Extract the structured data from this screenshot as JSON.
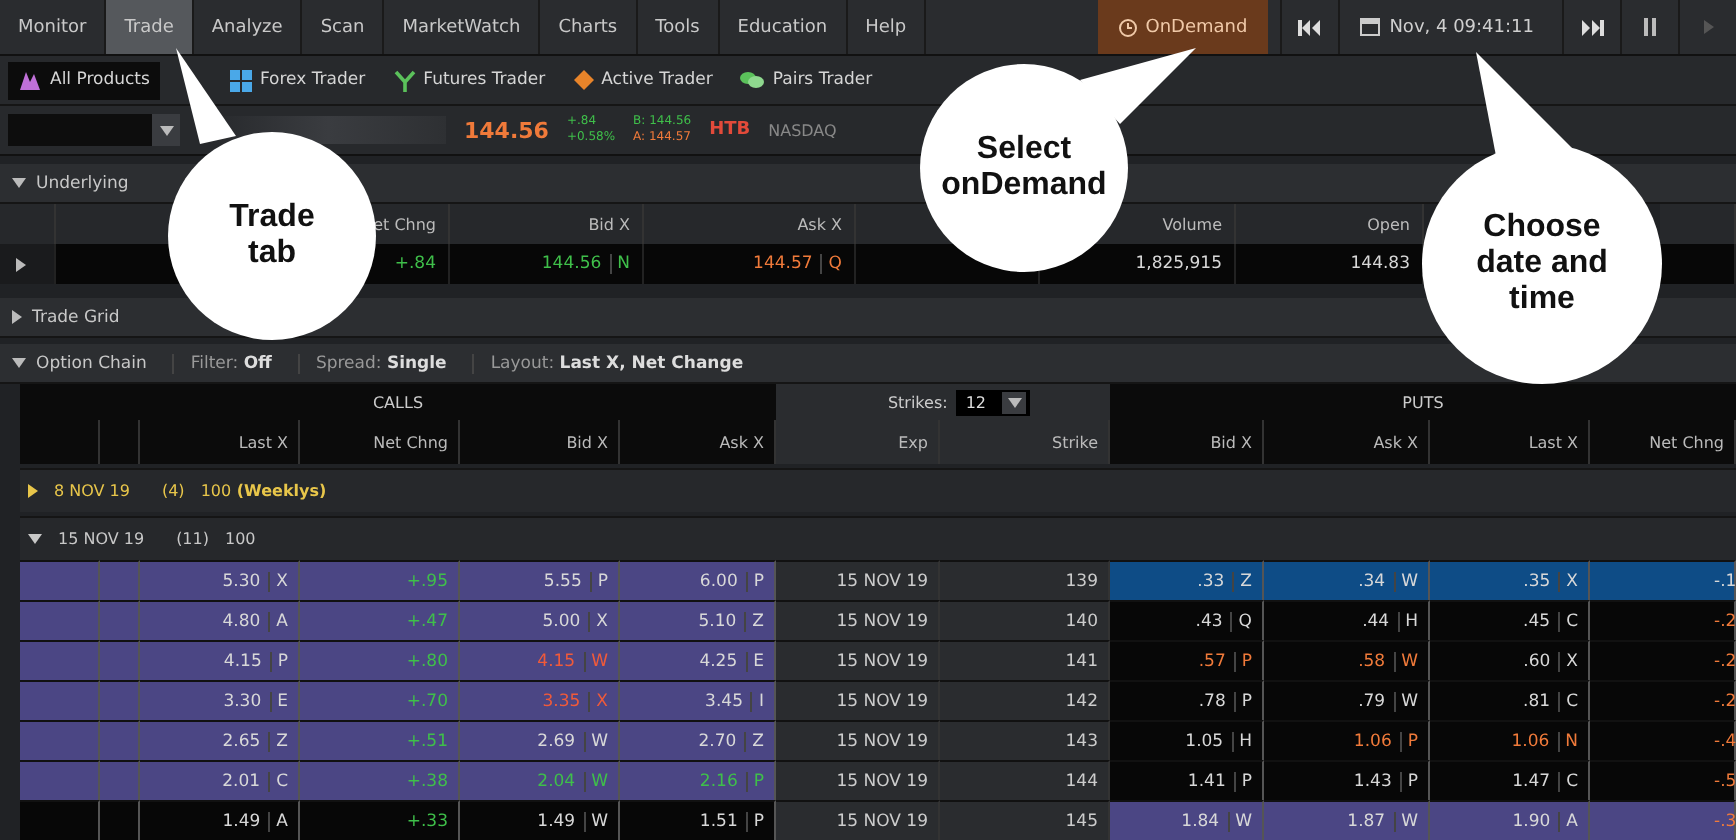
{
  "menu": {
    "tabs": [
      {
        "label": "Monitor",
        "selected": false
      },
      {
        "label": "Trade",
        "selected": true
      },
      {
        "label": "Analyze",
        "selected": false
      },
      {
        "label": "Scan",
        "selected": false
      },
      {
        "label": "MarketWatch",
        "selected": false
      },
      {
        "label": "Charts",
        "selected": false
      },
      {
        "label": "Tools",
        "selected": false
      },
      {
        "label": "Education",
        "selected": false
      },
      {
        "label": "Help",
        "selected": false
      }
    ],
    "ondemand": "OnDemand",
    "datetime": "Nov, 4 09:41:11"
  },
  "products": [
    {
      "label": "All Products",
      "selected": true
    },
    {
      "label": "Forex Trader",
      "selected": false
    },
    {
      "label": "Futures Trader",
      "selected": false
    },
    {
      "label": "Active Trader",
      "selected": false
    },
    {
      "label": "Pairs Trader",
      "selected": false
    }
  ],
  "quote": {
    "last": "144.56",
    "change": "+.84",
    "change_pct": "+0.58%",
    "bid": "B: 144.56",
    "ask": "A: 144.57",
    "flag": "HTB",
    "exchange": "NASDAQ"
  },
  "underlying": {
    "title": "Underlying",
    "expanded": true,
    "columns": [
      "et Chng",
      "Bid X",
      "Ask X",
      "Volume",
      "Open"
    ],
    "cells": [
      {
        "value": "+.84",
        "color": "#3fbf4a"
      },
      {
        "value": "144.56",
        "exch": "N",
        "color": "#3fbf4a"
      },
      {
        "value": "144.57",
        "exch": "Q",
        "color": "#f07a3a"
      },
      {
        "value": "1,825,915",
        "color": "#d8d8d8"
      },
      {
        "value": "144.83",
        "color": "#d8d8d8"
      }
    ]
  },
  "trade_grid": {
    "title": "Trade Grid",
    "expanded": false
  },
  "option_chain": {
    "title": "Option Chain",
    "expanded": true,
    "settings": [
      {
        "label": "Filter:",
        "value": "Off"
      },
      {
        "label": "Spread:",
        "value": "Single"
      },
      {
        "label": "Layout:",
        "value": "Last X, Net Change"
      }
    ],
    "calls_title": "CALLS",
    "puts_title": "PUTS",
    "strikes_label": "Strikes:",
    "strikes_value": "12",
    "call_columns": [
      "Last X",
      "Net Chng",
      "Bid X",
      "Ask X"
    ],
    "mid_columns": [
      "Exp",
      "Strike"
    ],
    "put_columns": [
      "Bid X",
      "Ask X",
      "Last X",
      "Net Chng"
    ],
    "series": [
      {
        "date": "8 NOV 19",
        "count": "(4)",
        "multiplier": "100",
        "note": "(Weeklys)",
        "kind": "weekly",
        "expanded": false
      },
      {
        "date": "15 NOV 19",
        "count": "(11)",
        "multiplier": "100",
        "kind": "standard",
        "expanded": true
      }
    ],
    "rows": [
      {
        "calls_itm": true,
        "puts_itm": false,
        "selected": true,
        "exp": "15 NOV 19",
        "strike": "139",
        "calls": [
          {
            "value": "5.30",
            "exch": "X",
            "color": "#d8d8d8"
          },
          {
            "value": "+.95",
            "color": "#3fbf4a"
          },
          {
            "value": "5.55",
            "exch": "P",
            "color": "#d8d8d8"
          },
          {
            "value": "6.00",
            "exch": "P",
            "color": "#d8d8d8"
          }
        ],
        "puts": [
          {
            "value": ".33",
            "exch": "Z",
            "color": "#d8d8d8"
          },
          {
            "value": ".34",
            "exch": "W",
            "color": "#d8d8d8"
          },
          {
            "value": ".35",
            "exch": "X",
            "color": "#d8d8d8"
          },
          {
            "value": "-.1",
            "color": "#d8d8d8"
          }
        ]
      },
      {
        "calls_itm": true,
        "puts_itm": false,
        "selected": false,
        "exp": "15 NOV 19",
        "strike": "140",
        "calls": [
          {
            "value": "4.80",
            "exch": "A",
            "color": "#d8d8d8"
          },
          {
            "value": "+.47",
            "color": "#3fbf4a"
          },
          {
            "value": "5.00",
            "exch": "X",
            "color": "#d8d8d8"
          },
          {
            "value": "5.10",
            "exch": "Z",
            "color": "#d8d8d8"
          }
        ],
        "puts": [
          {
            "value": ".43",
            "exch": "Q",
            "color": "#d8d8d8"
          },
          {
            "value": ".44",
            "exch": "H",
            "color": "#d8d8d8"
          },
          {
            "value": ".45",
            "exch": "C",
            "color": "#d8d8d8"
          },
          {
            "value": "-.2",
            "color": "#f07a3a"
          }
        ]
      },
      {
        "calls_itm": true,
        "puts_itm": false,
        "selected": false,
        "exp": "15 NOV 19",
        "strike": "141",
        "calls": [
          {
            "value": "4.15",
            "exch": "P",
            "color": "#d8d8d8"
          },
          {
            "value": "+.80",
            "color": "#3fbf4a"
          },
          {
            "value": "4.15",
            "exch": "W",
            "color": "#f05a3a"
          },
          {
            "value": "4.25",
            "exch": "E",
            "color": "#d8d8d8"
          }
        ],
        "puts": [
          {
            "value": ".57",
            "exch": "P",
            "color": "#f07a3a"
          },
          {
            "value": ".58",
            "exch": "W",
            "color": "#f07a3a"
          },
          {
            "value": ".60",
            "exch": "X",
            "color": "#d8d8d8"
          },
          {
            "value": "-.2",
            "color": "#f07a3a"
          }
        ]
      },
      {
        "calls_itm": true,
        "puts_itm": false,
        "selected": false,
        "exp": "15 NOV 19",
        "strike": "142",
        "calls": [
          {
            "value": "3.30",
            "exch": "E",
            "color": "#d8d8d8"
          },
          {
            "value": "+.70",
            "color": "#3fbf4a"
          },
          {
            "value": "3.35",
            "exch": "X",
            "color": "#f05a3a"
          },
          {
            "value": "3.45",
            "exch": "I",
            "color": "#d8d8d8"
          }
        ],
        "puts": [
          {
            "value": ".78",
            "exch": "P",
            "color": "#d8d8d8"
          },
          {
            "value": ".79",
            "exch": "W",
            "color": "#d8d8d8"
          },
          {
            "value": ".81",
            "exch": "C",
            "color": "#d8d8d8"
          },
          {
            "value": "-.2",
            "color": "#f07a3a"
          }
        ]
      },
      {
        "calls_itm": true,
        "puts_itm": false,
        "selected": false,
        "exp": "15 NOV 19",
        "strike": "143",
        "calls": [
          {
            "value": "2.65",
            "exch": "Z",
            "color": "#d8d8d8"
          },
          {
            "value": "+.51",
            "color": "#3fbf4a"
          },
          {
            "value": "2.69",
            "exch": "W",
            "color": "#d8d8d8"
          },
          {
            "value": "2.70",
            "exch": "Z",
            "color": "#d8d8d8"
          }
        ],
        "puts": [
          {
            "value": "1.05",
            "exch": "H",
            "color": "#d8d8d8"
          },
          {
            "value": "1.06",
            "exch": "P",
            "color": "#f07a3a"
          },
          {
            "value": "1.06",
            "exch": "N",
            "color": "#f07a3a"
          },
          {
            "value": "-.4",
            "color": "#f07a3a"
          }
        ]
      },
      {
        "calls_itm": true,
        "puts_itm": false,
        "selected": false,
        "exp": "15 NOV 19",
        "strike": "144",
        "calls": [
          {
            "value": "2.01",
            "exch": "C",
            "color": "#d8d8d8"
          },
          {
            "value": "+.38",
            "color": "#3fbf4a"
          },
          {
            "value": "2.04",
            "exch": "W",
            "color": "#3fbf4a"
          },
          {
            "value": "2.16",
            "exch": "P",
            "color": "#3fbf4a"
          }
        ],
        "puts": [
          {
            "value": "1.41",
            "exch": "P",
            "color": "#d8d8d8"
          },
          {
            "value": "1.43",
            "exch": "P",
            "color": "#d8d8d8"
          },
          {
            "value": "1.47",
            "exch": "C",
            "color": "#d8d8d8"
          },
          {
            "value": "-.5",
            "color": "#f07a3a"
          }
        ]
      },
      {
        "calls_itm": false,
        "puts_itm": true,
        "selected": false,
        "exp": "15 NOV 19",
        "strike": "145",
        "calls": [
          {
            "value": "1.49",
            "exch": "A",
            "color": "#d8d8d8"
          },
          {
            "value": "+.33",
            "color": "#3fbf4a"
          },
          {
            "value": "1.49",
            "exch": "W",
            "color": "#d8d8d8"
          },
          {
            "value": "1.51",
            "exch": "P",
            "color": "#d8d8d8"
          }
        ],
        "puts": [
          {
            "value": "1.84",
            "exch": "W",
            "color": "#d8d8d8"
          },
          {
            "value": "1.87",
            "exch": "W",
            "color": "#d8d8d8"
          },
          {
            "value": "1.90",
            "exch": "A",
            "color": "#d8d8d8"
          },
          {
            "value": "-.3",
            "color": "#f07a3a"
          }
        ]
      }
    ]
  },
  "callouts": [
    {
      "text": "Trade tab"
    },
    {
      "text": "Select onDemand"
    },
    {
      "text": "Choose date and time"
    }
  ]
}
